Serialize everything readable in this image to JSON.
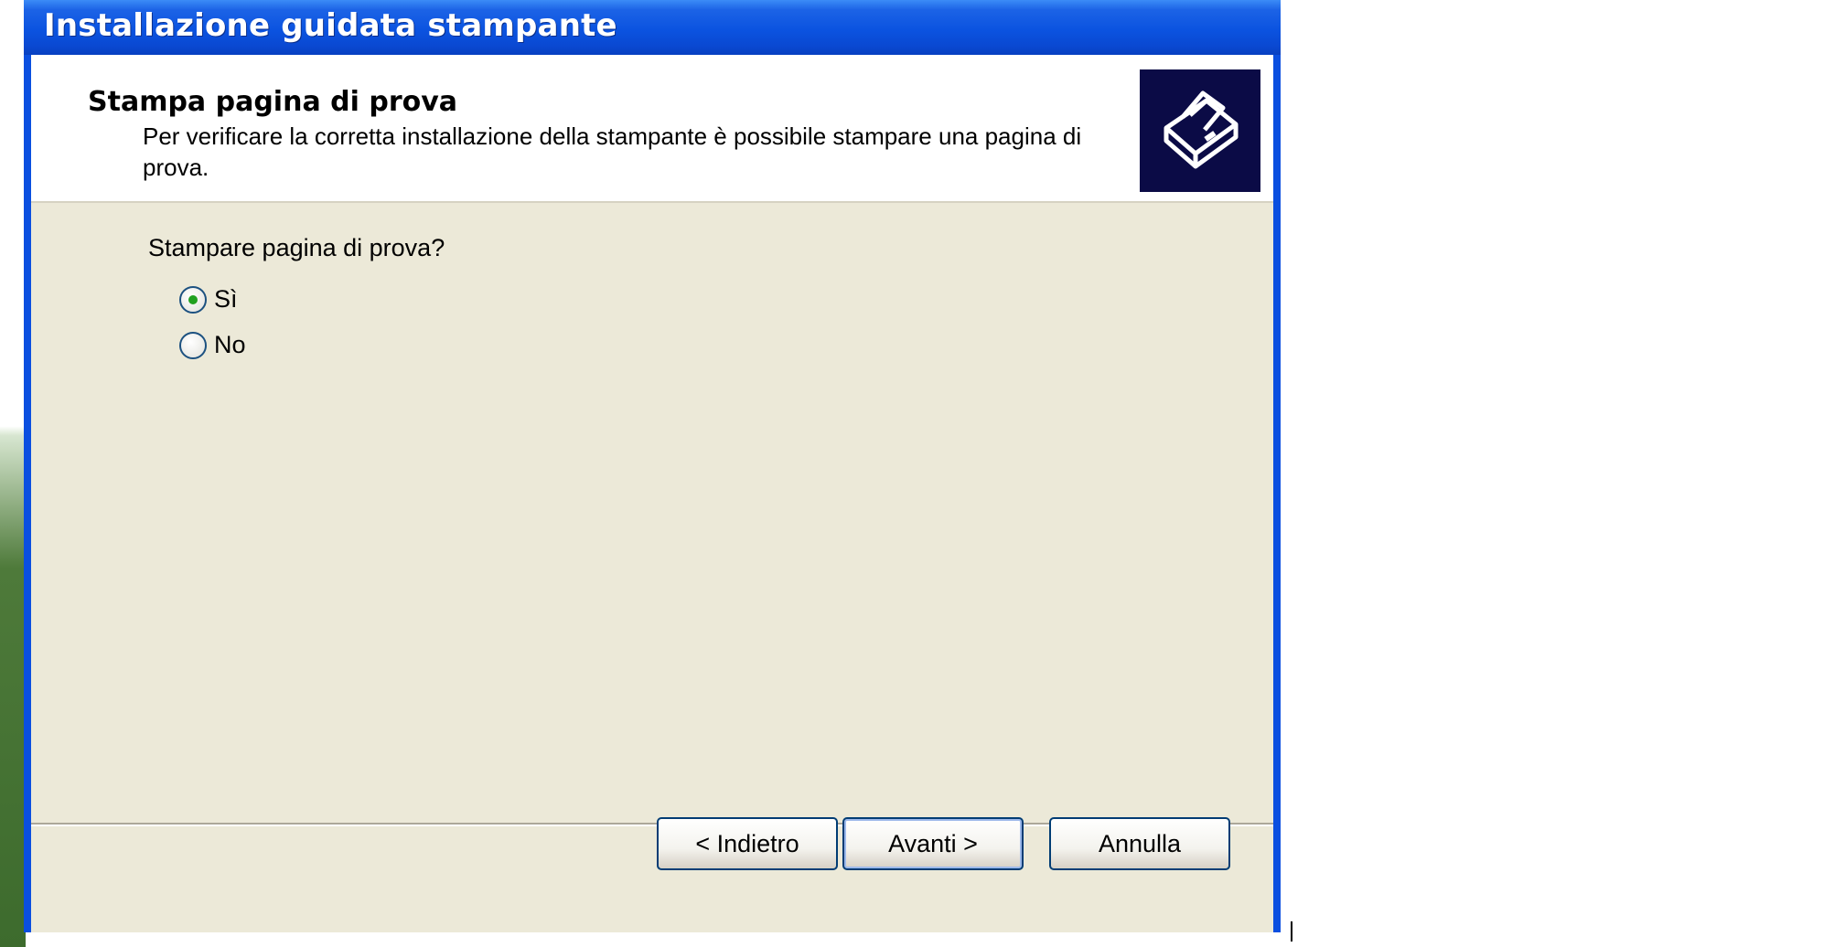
{
  "window": {
    "title": "Installazione guidata stampante"
  },
  "header": {
    "title": "Stampa pagina di prova",
    "subtitle": "Per verificare la corretta installazione della stampante è possibile stampare una pagina di prova.",
    "icon": "printer-icon"
  },
  "main": {
    "question": "Stampare pagina di prova?",
    "options": [
      {
        "label": "Sì",
        "selected": true
      },
      {
        "label": "No",
        "selected": false
      }
    ]
  },
  "buttons": {
    "back_label": "< Indietro",
    "next_label": "Avanti >",
    "cancel_label": "Annulla"
  },
  "colors": {
    "titlebar": "#0a4fe0",
    "dialog_bg": "#ece9d8",
    "radio_dot": "#21a121"
  }
}
